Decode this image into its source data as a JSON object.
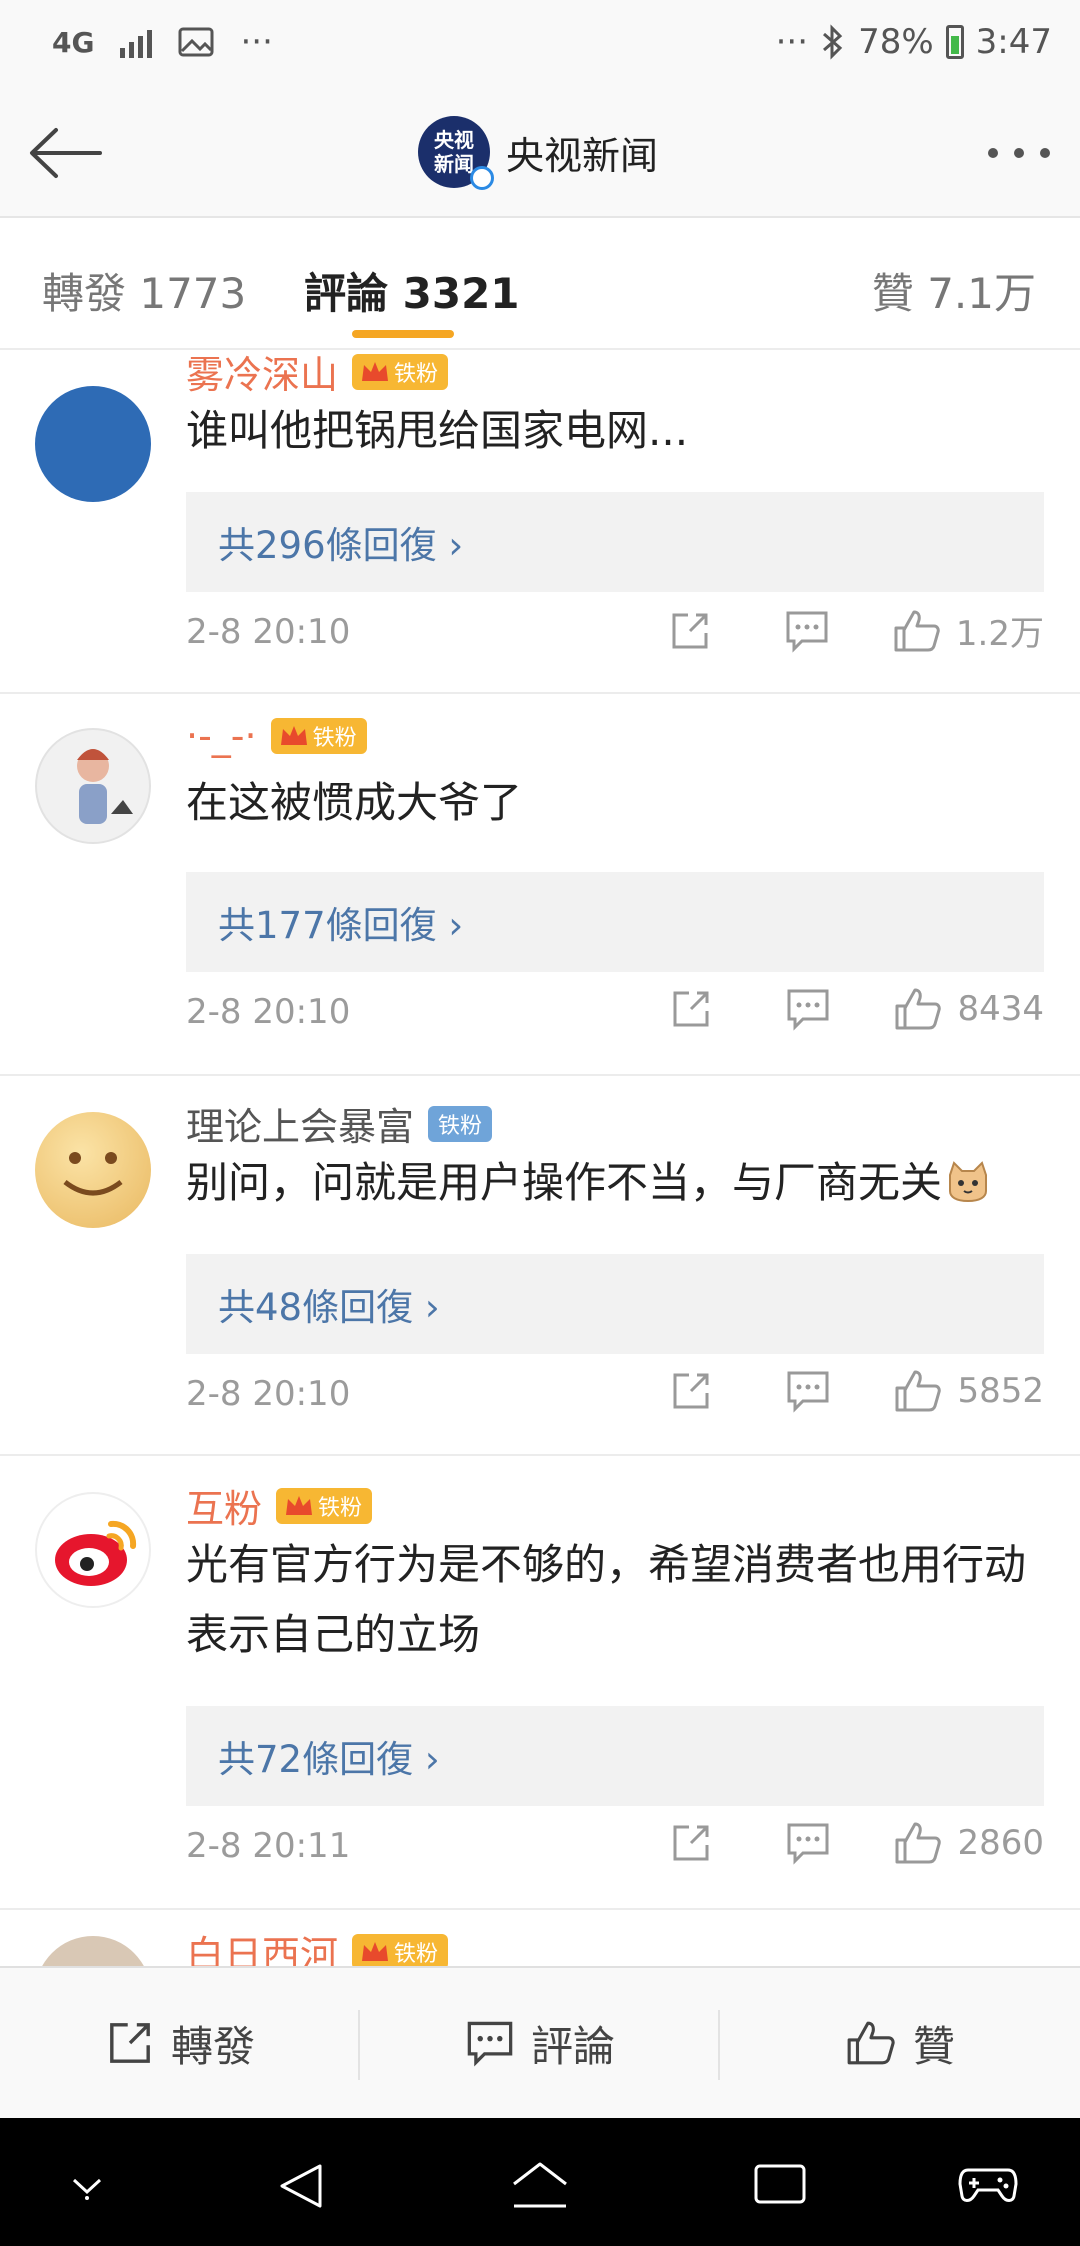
{
  "status_bar": {
    "network": "4G",
    "dots_left": "···",
    "dots_right": "···",
    "battery": "78%",
    "time": "3:47"
  },
  "header": {
    "logo_line1": "央视",
    "logo_line2": "新闻",
    "account_name": "央视新闻"
  },
  "tabs": {
    "repost": "轉發 1773",
    "comments": "評論 3321",
    "likes": "贊 7.1万"
  },
  "comments": [
    {
      "user": "雾冷深山",
      "badge_level": "3",
      "badge": "铁粉",
      "text": "谁叫他把锅甩给国家电网...",
      "replies": "共296條回復 ›",
      "time": "2-8 20:10",
      "likes": "1.2万"
    },
    {
      "user": "·-_-·",
      "badge_level": "6",
      "badge": "铁粉",
      "text": "在这被惯成大爷了",
      "replies": "共177條回復 ›",
      "time": "2-8 20:10",
      "likes": "8434"
    },
    {
      "user": "理论上会暴富",
      "badge": "铁粉",
      "text": "别问，问就是用户操作不当，与厂商无关",
      "replies": "共48條回復 ›",
      "time": "2-8 20:10",
      "likes": "5852"
    },
    {
      "user": "互粉",
      "badge": "铁粉",
      "text": "光有官方行为是不够的，希望消费者也用行动表示自己的立场",
      "replies": "共72條回復 ›",
      "time": "2-8 20:11",
      "likes": "2860"
    },
    {
      "user": "白日西河",
      "badge": "铁粉"
    }
  ],
  "bottom_bar": {
    "repost": "轉發",
    "comment": "評論",
    "like": "贊"
  },
  "colors": {
    "accent": "#f5a623",
    "vip_name": "#eb7350",
    "link": "#4c76a8"
  }
}
